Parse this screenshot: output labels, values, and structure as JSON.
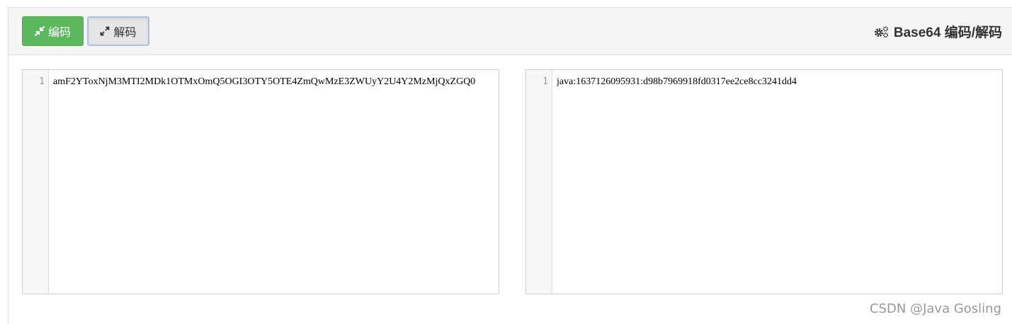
{
  "toolbar": {
    "encode_label": "编码",
    "decode_label": "解码",
    "encode_icon": "compress-icon",
    "decode_icon": "expand-icon",
    "encode_color": "#5cb85c"
  },
  "header": {
    "title": "Base64 编码/解码",
    "title_icon": "gears-icon"
  },
  "editors": {
    "input": {
      "line_number": "1",
      "content": "amF2YToxNjM3MTI2MDk1OTMxOmQ5OGI3OTY5OTE4ZmQwMzE3ZWUyY2U4Y2MzMjQxZGQ0"
    },
    "output": {
      "line_number": "1",
      "content": "java:1637126095931:d98b7969918fd0317ee2ce8cc3241dd4"
    }
  },
  "watermark": "CSDN @Java Gosling"
}
